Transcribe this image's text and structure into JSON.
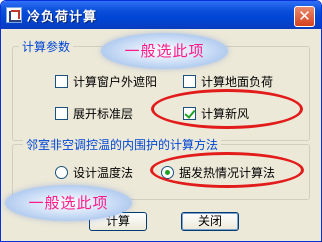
{
  "window": {
    "title": "冷负荷计算",
    "close_glyph": "✕"
  },
  "group_params": {
    "legend": "计算参数",
    "options": [
      {
        "label": "计算窗户外遮阳",
        "checked": false
      },
      {
        "label": "计算地面负荷",
        "checked": false
      },
      {
        "label": "展开标准层",
        "checked": false
      },
      {
        "label": "计算新风",
        "checked": true
      }
    ]
  },
  "group_method": {
    "legend": "邻室非空调控温的内围护的计算方法",
    "options": [
      {
        "label": "设计温度法",
        "selected": false
      },
      {
        "label": "据发热情况计算法",
        "selected": true
      }
    ]
  },
  "buttons": {
    "ok": "计算",
    "close": "关闭"
  },
  "annotations": {
    "callout_top": "一般选此项",
    "callout_bottom": "一般选此项"
  },
  "colors": {
    "title_bar": "#0046d5",
    "highlight_ring": "#e21b1b",
    "callout_text": "#ff1a8c"
  }
}
